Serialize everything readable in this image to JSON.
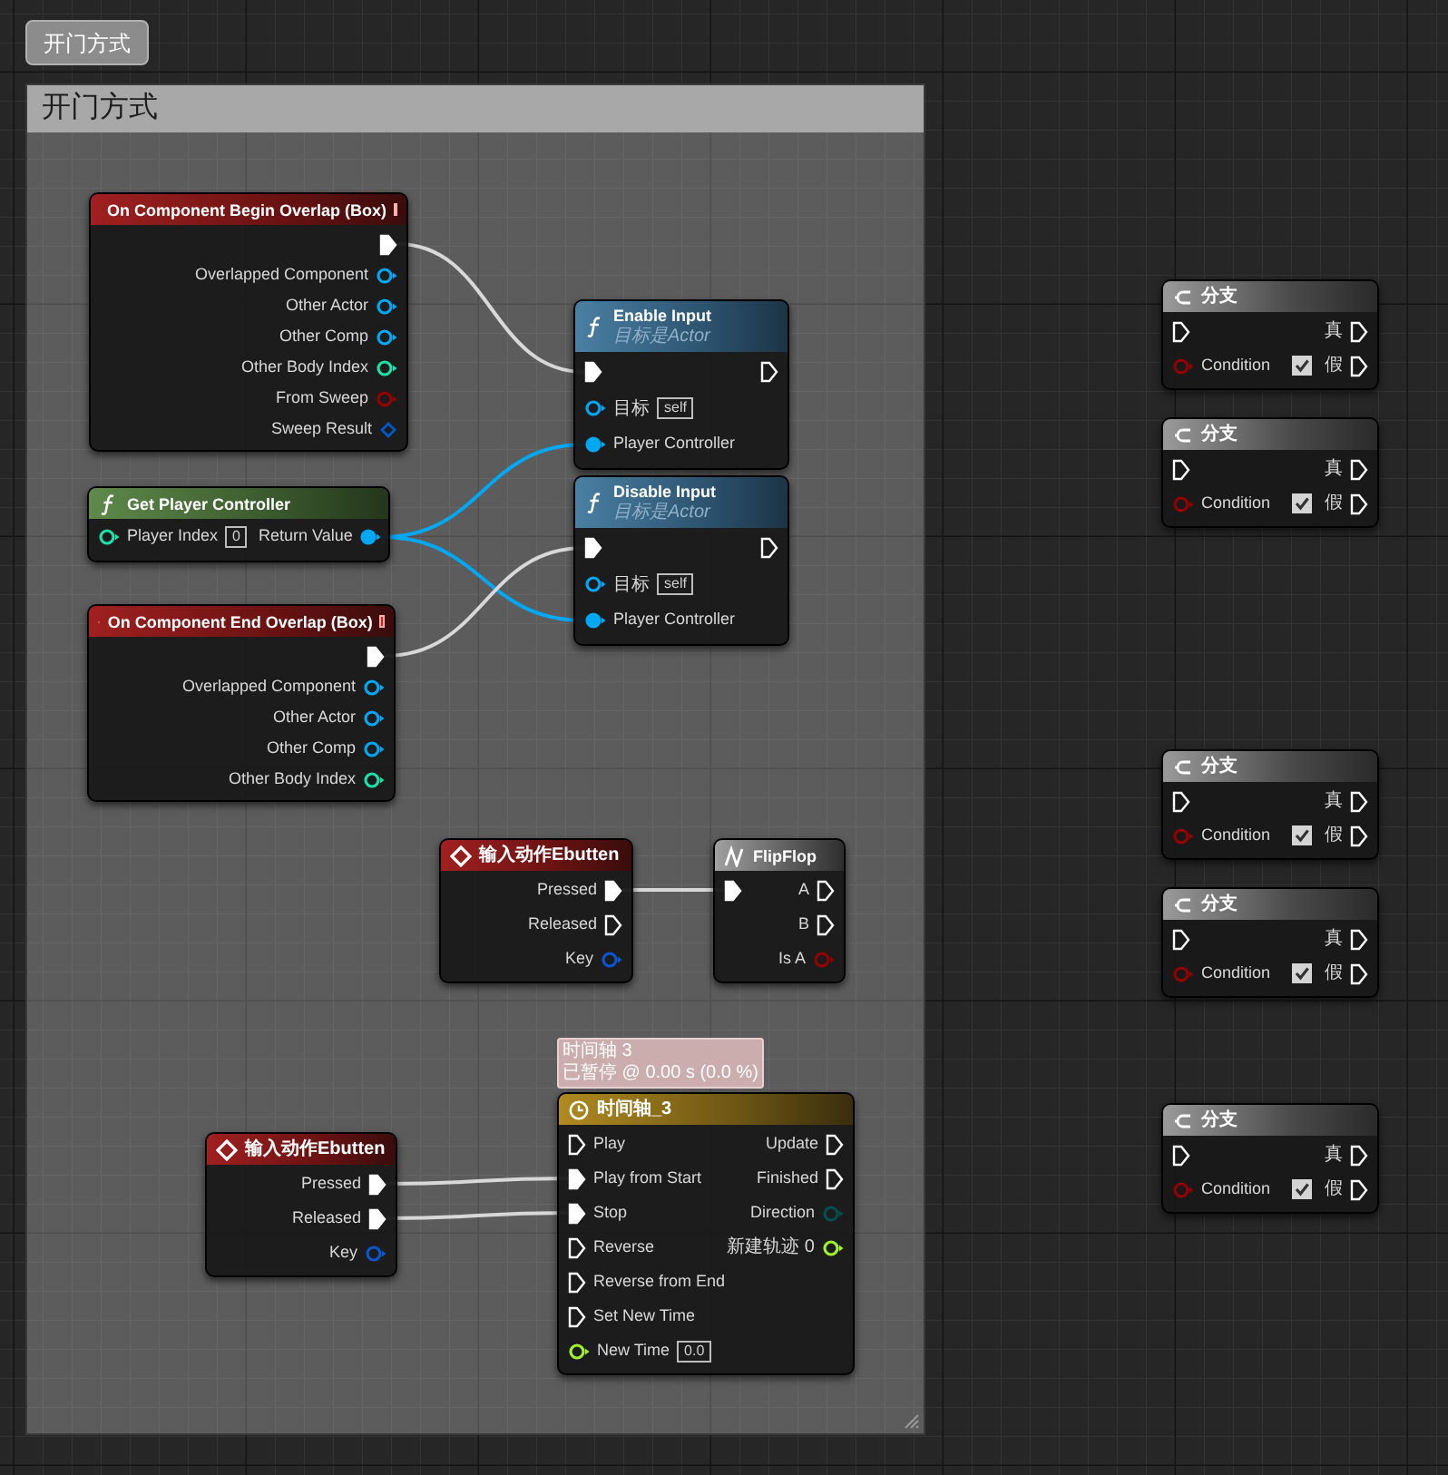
{
  "comment_tooltip": "开门方式",
  "comment_box": {
    "title": "开门方式"
  },
  "nodes": [
    {
      "kind": "event",
      "title": "On Component Begin Overlap (Box)",
      "delegate_pin": true,
      "rows": [
        {
          "right": {
            "kind": "exec",
            "connected": true
          }
        },
        {
          "right": {
            "kind": "object",
            "label": "Overlapped Component",
            "connected": false
          }
        },
        {
          "right": {
            "kind": "object",
            "label": "Other Actor",
            "connected": false
          }
        },
        {
          "right": {
            "kind": "object",
            "label": "Other Comp",
            "connected": false
          }
        },
        {
          "right": {
            "kind": "int",
            "label": "Other Body Index",
            "connected": false
          }
        },
        {
          "right": {
            "kind": "bool",
            "label": "From Sweep",
            "connected": false
          }
        },
        {
          "right": {
            "kind": "struct",
            "label": "Sweep Result",
            "connected": false
          }
        }
      ]
    },
    {
      "kind": "function",
      "title": "Enable Input",
      "subtitle": "目标是Actor",
      "rows": [
        {
          "left": {
            "kind": "exec",
            "connected": true
          },
          "right": {
            "kind": "exec",
            "connected": false
          }
        },
        {
          "left": {
            "kind": "object",
            "label": "目标",
            "value": "self",
            "connected": false
          }
        },
        {
          "left": {
            "kind": "object",
            "label": "Player Controller",
            "connected": true
          }
        }
      ]
    },
    {
      "kind": "pure",
      "title": "Get Player Controller",
      "rows": [
        {
          "left": {
            "kind": "int",
            "label": "Player Index",
            "value": "0",
            "connected": false
          },
          "right": {
            "kind": "object",
            "label": "Return Value",
            "connected": true
          }
        }
      ]
    },
    {
      "kind": "function",
      "title": "Disable Input",
      "subtitle": "目标是Actor",
      "rows": [
        {
          "left": {
            "kind": "exec",
            "connected": true
          },
          "right": {
            "kind": "exec",
            "connected": false
          }
        },
        {
          "left": {
            "kind": "object",
            "label": "目标",
            "value": "self",
            "connected": false
          }
        },
        {
          "left": {
            "kind": "object",
            "label": "Player Controller",
            "connected": true
          }
        }
      ]
    },
    {
      "kind": "event",
      "title": "On Component End Overlap (Box)",
      "delegate_pin": true,
      "rows": [
        {
          "right": {
            "kind": "exec",
            "connected": true
          }
        },
        {
          "right": {
            "kind": "object",
            "label": "Overlapped Component",
            "connected": false
          }
        },
        {
          "right": {
            "kind": "object",
            "label": "Other Actor",
            "connected": false
          }
        },
        {
          "right": {
            "kind": "object",
            "label": "Other Comp",
            "connected": false
          }
        },
        {
          "right": {
            "kind": "int",
            "label": "Other Body Index",
            "connected": false
          }
        }
      ]
    },
    {
      "kind": "event",
      "title": "输入动作Ebutten",
      "delegate_pin": false,
      "rows": [
        {
          "right": {
            "kind": "exec",
            "label": "Pressed",
            "connected": true
          }
        },
        {
          "right": {
            "kind": "exec",
            "label": "Released",
            "connected": false
          }
        },
        {
          "right": {
            "kind": "key",
            "label": "Key",
            "connected": false
          }
        }
      ]
    },
    {
      "kind": "macro",
      "title": "FlipFlop",
      "rows": [
        {
          "left": {
            "kind": "exec",
            "connected": true
          },
          "right": {
            "kind": "exec",
            "label": "A",
            "connected": false
          }
        },
        {
          "right": {
            "kind": "exec",
            "label": "B",
            "connected": false
          }
        },
        {
          "right": {
            "kind": "bool",
            "label": "Is A",
            "connected": false
          }
        }
      ]
    },
    {
      "kind": "event",
      "title": "输入动作Ebutten",
      "delegate_pin": false,
      "rows": [
        {
          "right": {
            "kind": "exec",
            "label": "Pressed",
            "connected": true
          }
        },
        {
          "right": {
            "kind": "exec",
            "label": "Released",
            "connected": true
          }
        },
        {
          "right": {
            "kind": "key",
            "label": "Key",
            "connected": false
          }
        }
      ]
    },
    {
      "kind": "timeline",
      "title": "时间轴_3",
      "tooltip_lines": [
        "时间轴 3",
        "已暂停 @ 0.00 s (0.0 %)"
      ],
      "rows": [
        {
          "left": {
            "kind": "exec",
            "label": "Play",
            "connected": false
          },
          "right": {
            "kind": "exec",
            "label": "Update",
            "connected": false
          }
        },
        {
          "left": {
            "kind": "exec",
            "label": "Play from Start",
            "connected": true
          },
          "right": {
            "kind": "exec",
            "label": "Finished",
            "connected": false
          }
        },
        {
          "left": {
            "kind": "exec",
            "label": "Stop",
            "connected": true
          },
          "right": {
            "kind": "enum",
            "label": "Direction",
            "connected": false
          }
        },
        {
          "left": {
            "kind": "exec",
            "label": "Reverse",
            "connected": false
          },
          "right": {
            "kind": "float",
            "label": "新建轨迹 0",
            "connected": false
          }
        },
        {
          "left": {
            "kind": "exec",
            "label": "Reverse from End",
            "connected": false
          }
        },
        {
          "left": {
            "kind": "exec",
            "label": "Set New Time",
            "connected": false
          }
        },
        {
          "left": {
            "kind": "float",
            "label": "New Time",
            "value": "0.0",
            "connected": false
          }
        }
      ]
    },
    {
      "kind": "branch",
      "title": "分支",
      "rows": [
        {
          "left": {
            "kind": "exec",
            "connected": false
          },
          "right": {
            "kind": "exec",
            "label": "真",
            "connected": false
          }
        },
        {
          "left": {
            "kind": "bool",
            "label": "Condition",
            "checked": true,
            "connected": false
          },
          "right": {
            "kind": "exec",
            "label": "假",
            "connected": false
          }
        }
      ]
    },
    {
      "kind": "branch",
      "title": "分支",
      "rows": [
        {
          "left": {
            "kind": "exec",
            "connected": false
          },
          "right": {
            "kind": "exec",
            "label": "真",
            "connected": false
          }
        },
        {
          "left": {
            "kind": "bool",
            "label": "Condition",
            "checked": true,
            "connected": false
          },
          "right": {
            "kind": "exec",
            "label": "假",
            "connected": false
          }
        }
      ]
    },
    {
      "kind": "branch",
      "title": "分支",
      "rows": [
        {
          "left": {
            "kind": "exec",
            "connected": false
          },
          "right": {
            "kind": "exec",
            "label": "真",
            "connected": false
          }
        },
        {
          "left": {
            "kind": "bool",
            "label": "Condition",
            "checked": true,
            "connected": false
          },
          "right": {
            "kind": "exec",
            "label": "假",
            "connected": false
          }
        }
      ]
    },
    {
      "kind": "branch",
      "title": "分支",
      "rows": [
        {
          "left": {
            "kind": "exec",
            "connected": false
          },
          "right": {
            "kind": "exec",
            "label": "真",
            "connected": false
          }
        },
        {
          "left": {
            "kind": "bool",
            "label": "Condition",
            "checked": true,
            "connected": false
          },
          "right": {
            "kind": "exec",
            "label": "假",
            "connected": false
          }
        }
      ]
    },
    {
      "kind": "branch",
      "title": "分支",
      "rows": [
        {
          "left": {
            "kind": "exec",
            "connected": false
          },
          "right": {
            "kind": "exec",
            "label": "真",
            "connected": false
          }
        },
        {
          "left": {
            "kind": "bool",
            "label": "Condition",
            "checked": true,
            "connected": false
          },
          "right": {
            "kind": "exec",
            "label": "假",
            "connected": false
          }
        }
      ]
    }
  ]
}
